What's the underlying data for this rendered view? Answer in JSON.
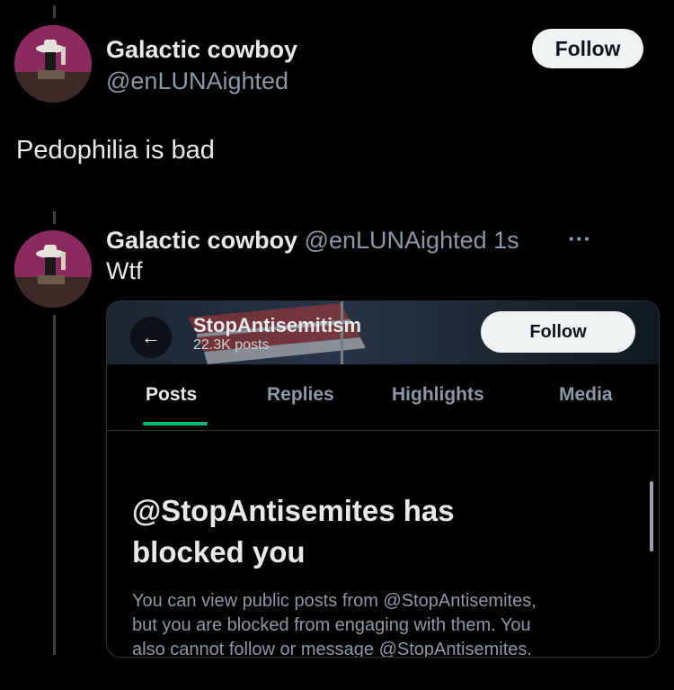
{
  "post": {
    "author_name": "Galactic cowboy",
    "author_handle": "@enLUNAighted",
    "follow_label": "Follow",
    "text": "Pedophilia is bad"
  },
  "reply": {
    "author_name": "Galactic cowboy",
    "author_handle": "@enLUNAighted",
    "time": "1s",
    "more": "···",
    "text": "Wtf"
  },
  "embed": {
    "back": "←",
    "profile_name": "StopAntisemitism",
    "profile_posts": "22.3K posts",
    "follow_label": "Follow",
    "tabs": [
      "Posts",
      "Replies",
      "Highlights",
      "Media"
    ],
    "blocked_title": "@StopAntisemites has blocked you",
    "blocked_body_lines": [
      "You can view public posts from @StopAntisemites,",
      "but you are blocked from engaging with them. You",
      "also cannot follow or message @StopAntisemites."
    ]
  },
  "colors": {
    "background": "#000000",
    "text": "#e7e9ea",
    "muted": "#8b98a5",
    "accent": "#00ba7c"
  }
}
